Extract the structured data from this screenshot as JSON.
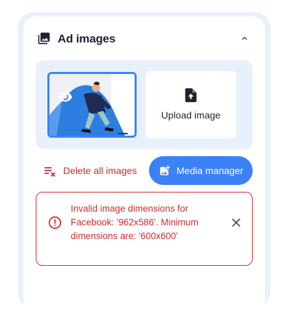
{
  "section": {
    "title": "Ad images",
    "icon": "image-stack-icon",
    "collapse_icon": "chevron-up-icon"
  },
  "thumbnail": {
    "preview_icon": "eye-icon",
    "remove_icon": "close-icon"
  },
  "upload": {
    "label": "Upload image",
    "icon": "upload-file-icon"
  },
  "actions": {
    "delete_all_label": "Delete all images",
    "delete_icon": "playlist-remove-icon",
    "media_manager_label": "Media manager",
    "media_icon": "add-photo-icon"
  },
  "alert": {
    "message": "Invalid image dimensions for Facebook: '962x586'. Minimum dimensions are: '600x600'",
    "icon": "error-circle-icon",
    "close_icon": "close-icon"
  },
  "colors": {
    "accent": "#3b82f6",
    "error": "#d22b2b",
    "panel_bg": "#e8f1fb",
    "text": "#1e2233"
  }
}
